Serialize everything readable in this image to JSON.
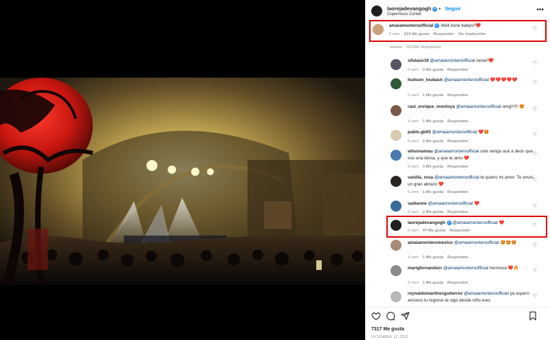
{
  "header": {
    "username": "laorejadevangogh",
    "follow_label": "Seguir",
    "location": "Copernicus Center",
    "more_icon": "more-options-icon"
  },
  "hide_replies_label": "Ocultar respuestas",
  "comments": [
    {
      "user": "amaiamonteroofficial",
      "verified": true,
      "text": "Well done babys!!",
      "emoji": "❤️",
      "time": "6 sem",
      "likes": "519 Me gusta",
      "reply": "Responder",
      "translate": "Ver traducción"
    },
    {
      "user": "silviaso19",
      "mention": "@amaiamonteroofficial",
      "text": "reina!!",
      "emoji": "❤️",
      "time": "6 sem",
      "likes": "3 Me gusta",
      "reply": "Responder"
    },
    {
      "user": "hudson_louback",
      "mention": "@amaiamonteroofficial",
      "text": "",
      "emoji": "❤️❤️❤️❤️❤️",
      "time": "6 sem",
      "likes": "1 Me gusta",
      "reply": "Responder"
    },
    {
      "user": "raul_enrique_montoya",
      "mention": "@amaiamonteroofficial",
      "text": "omg!!!!!!",
      "emoji": "😍",
      "time": "6 sem",
      "likes": "1 Me gusta",
      "reply": "Responder"
    },
    {
      "user": "pablo.gb93",
      "mention": "@amaiamonteroofficial",
      "text": "",
      "emoji": "❤️🤩",
      "time": "6 sem",
      "likes": "2 Me gusta",
      "reply": "Responder"
    },
    {
      "user": "wilsonamau",
      "mention": "@amaiamonteroofficial",
      "text": "solo vengo acá a decir que sos una diosa, y que te amo",
      "emoji": "❤️",
      "time": "6 sem",
      "likes": "3 Me gusta",
      "reply": "Responder"
    },
    {
      "user": "vanilla_rosa",
      "mention": "@amaiamonteroofficial",
      "text": "te quiero mi amor. Te envío un gran abrazo",
      "emoji": "❤️",
      "time": "6 sem",
      "likes": "1 Me gusta",
      "reply": "Responder"
    },
    {
      "user": "vadianne",
      "mention": "@amaiamonteroofficial",
      "text": "",
      "emoji": "❤️",
      "time": "6 sem",
      "likes": "2 Me gusta",
      "reply": "Responder"
    },
    {
      "user": "laorejadevangogh",
      "verified": true,
      "mention": "@amaiamonteroofficial",
      "text": "",
      "emoji": "❤️",
      "time": "6 sem",
      "likes": "97 Me gusta",
      "reply": "Responder"
    },
    {
      "user": "amaiamonteromexico",
      "mention": "@amaiamonteroofficial",
      "text": "",
      "emoji": "🤩🤩🤩",
      "time": "6 sem",
      "likes": "1 Me gusta",
      "reply": "Responder"
    },
    {
      "user": "marigfernandezr",
      "mention": "@amaiamonteroofficial",
      "text": "hermosa",
      "emoji": "❤️🔥",
      "time": "5 sem",
      "likes": "1 Me gusta",
      "reply": "Responder"
    },
    {
      "user": "reynaldomartinezgutierrez",
      "mention": "@amaiamonteroofficial",
      "text": "ya espero ancioso tu regreso te sigo desde niño eres",
      "emoji": "",
      "time": "",
      "likes": "",
      "reply": ""
    }
  ],
  "actions": {
    "like_icon": "heart-icon",
    "comment_icon": "comment-icon",
    "share_icon": "share-icon",
    "save_icon": "bookmark-icon"
  },
  "likes_count": "7317 Me gusta",
  "date": "DICIEMBRE 12, 2022",
  "colors": {
    "highlight": "#e00000",
    "link": "#0095f6",
    "mention": "#00376b",
    "heart": "#e0245e"
  }
}
